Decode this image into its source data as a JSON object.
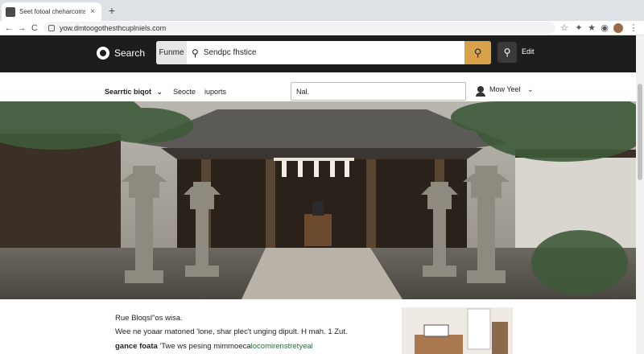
{
  "browser": {
    "tab_title": "Seet fotoal cheharcomst sic",
    "tab_close": "×",
    "new_tab": "+",
    "url": "yow.dmtoogothesthcuplniels.com",
    "nav": {
      "back": "←",
      "forward": "→",
      "reload": "C"
    },
    "icons": [
      "star-outline-icon",
      "puzzle-icon",
      "star-filled-icon",
      "circle-icon",
      "avatar",
      "kebab-menu-icon"
    ]
  },
  "header": {
    "brand_label": "Search",
    "scope_label": "Funme",
    "search_value": "Sendpc fhstice",
    "edit_label": "Edit"
  },
  "subnav": {
    "menu_label": "Searrtic biqot",
    "menu_caret": "⌄",
    "link1": "Seocte",
    "link2": "iuports",
    "field_value": "Nal.",
    "user_name": "Mow Yeel",
    "user_caret": "⌄"
  },
  "article": {
    "line1": "Rue Bloqsl\"os wisa.",
    "line2": "Wee ne yoaar matoned  'lone, shar plec't unging dipult. H mah. 1 Zut.",
    "line3_strong": "gance foata",
    "line3_text": "  'Twe ws pesing  mimmoeca",
    "line3_link": "locomirenstretyeal"
  },
  "colors": {
    "header_bg": "#1d1d1d",
    "accent": "#d8a24a",
    "link": "#2a6a3a"
  }
}
